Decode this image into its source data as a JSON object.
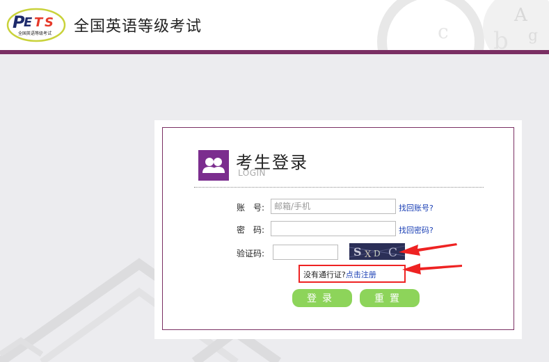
{
  "header": {
    "site_title": "全国英语等级考试",
    "logo_text": "PETS",
    "logo_caption": "全国英语等级考试"
  },
  "login": {
    "title": "考生登录",
    "subtitle": "LOGIN",
    "account_label": "账　号:",
    "account_placeholder": "邮箱/手机",
    "find_account_link": "找回账号?",
    "password_label": "密　码:",
    "find_password_link": "找回密码?",
    "captcha_label": "验证码:",
    "captcha_text": "SXD C",
    "no_pass_text": "没有通行证?",
    "register_link": "点击注册",
    "login_button": "登录",
    "reset_button": "重置"
  },
  "colors": {
    "brand": "#7a2f63",
    "icon_bg": "#7b2d8e",
    "button": "#8dd45a",
    "link": "#1a3fb5",
    "annotation": "#ee2222"
  }
}
